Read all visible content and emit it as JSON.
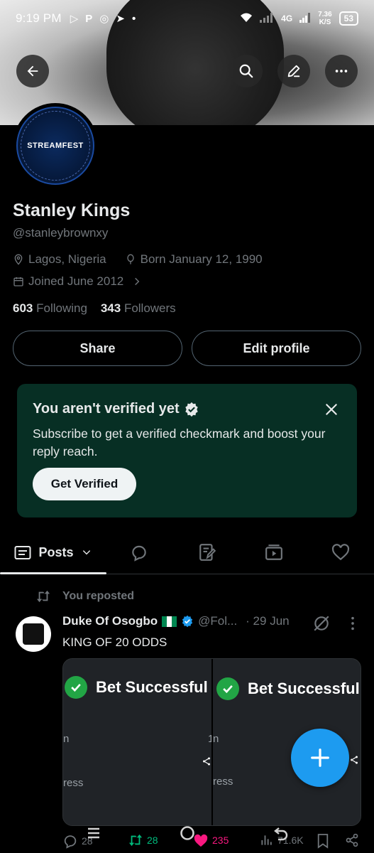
{
  "status_bar": {
    "time": "9:19 PM",
    "network": "4G",
    "speed": "7.36",
    "speed_unit": "K/S",
    "battery": "53"
  },
  "header": {
    "back_icon": "arrow-left-icon",
    "search_icon": "search-icon",
    "edit_icon": "edit-icon",
    "more_icon": "more-horizontal-icon"
  },
  "avatar": {
    "label": "STREAMFEST",
    "ring_text": "5 Days of Streaming Excitement · Iziz Plentyyy"
  },
  "profile": {
    "name": "Stanley Kings",
    "handle": "@stanleybrownxy",
    "location": "Lagos, Nigeria",
    "birthday": "Born January 12, 1990",
    "joined": "Joined June 2012",
    "following_count": "603",
    "following_label": "Following",
    "followers_count": "343",
    "followers_label": "Followers",
    "share_label": "Share",
    "edit_label": "Edit profile"
  },
  "verify_card": {
    "title": "You aren't verified yet",
    "description": "Subscribe to get a verified checkmark and boost your reply reach.",
    "button": "Get Verified"
  },
  "tabs": {
    "posts_label": "Posts"
  },
  "post": {
    "repost_label": "You reposted",
    "author": "Duke Of Osogbo",
    "handle": "@Fol...",
    "date": "· 29 Jun",
    "text": "KING OF 20 ODDS",
    "media_left": {
      "title": "Bet Successful",
      "fragment_a": "ress",
      "fragment_b": "n",
      "fragment_c": "1"
    },
    "media_right": {
      "title": "Bet Successful",
      "fragment_a": "ress",
      "fragment_b": "n"
    },
    "replies": "28",
    "reposts": "28",
    "likes": "235",
    "views": "71.6K"
  },
  "colors": {
    "accent": "#1d9bf0",
    "verify_bg": "#072f24",
    "repost_green": "#00ba7c",
    "like_pink": "#f91880",
    "muted": "#71767b"
  }
}
